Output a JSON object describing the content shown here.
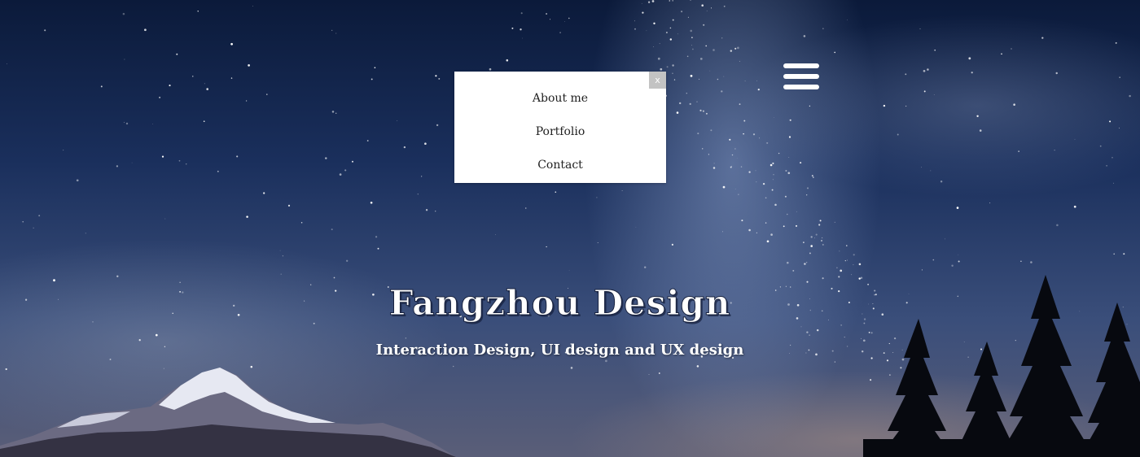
{
  "menu": {
    "close_label": "x",
    "items": [
      {
        "label": "About me"
      },
      {
        "label": "Portfolio"
      },
      {
        "label": "Contact"
      }
    ],
    "toggle_icon": "hamburger-icon"
  },
  "hero": {
    "title": "Fangzhou Design",
    "subtitle": "Interaction Design, UI design and UX design"
  },
  "colors": {
    "sky_dark": "#0b1a3a",
    "sky_mid": "#1a2f5c",
    "menu_bg": "#ffffff",
    "close_bg": "#c3c3c3",
    "text_white": "#ffffff"
  }
}
